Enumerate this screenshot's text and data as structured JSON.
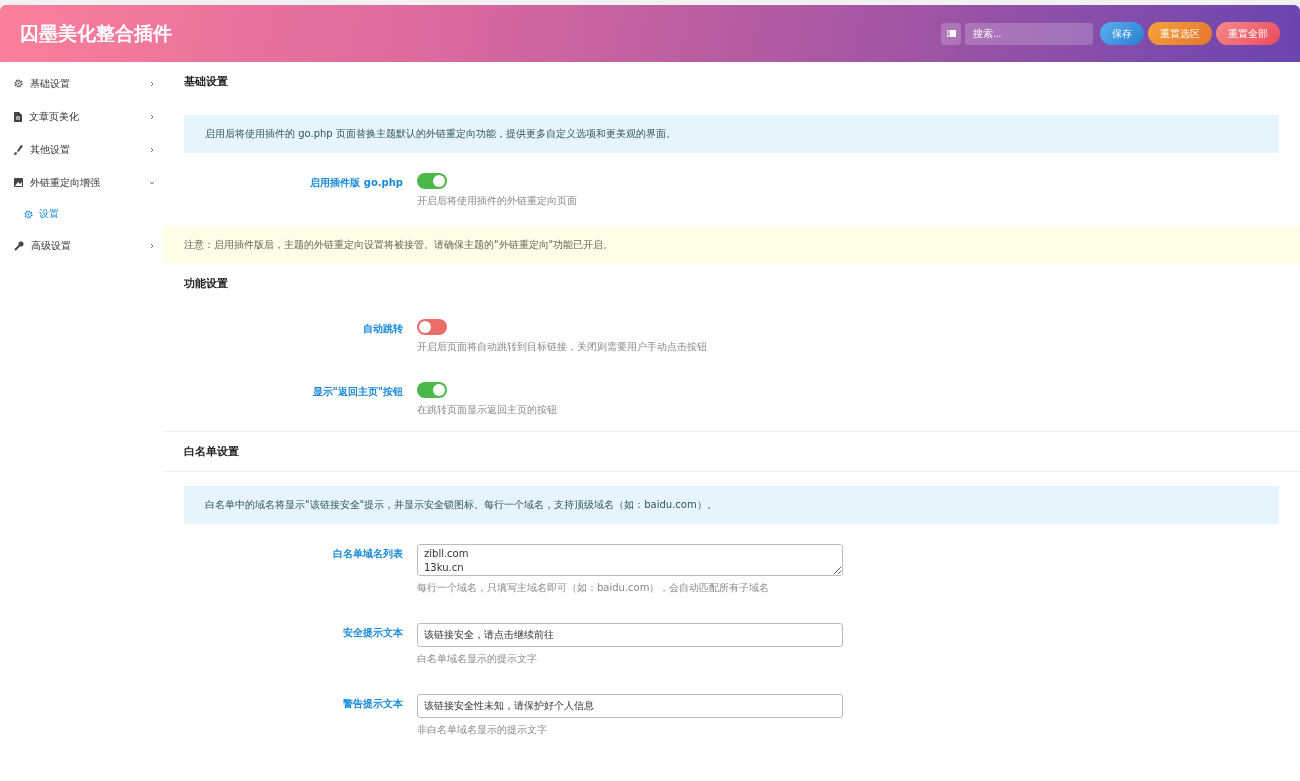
{
  "header": {
    "title": "囚墨美化整合插件",
    "search": {
      "placeholder": "搜索..."
    },
    "buttons": [
      {
        "kind": "save",
        "label": "保存"
      },
      {
        "kind": "reset-section",
        "label": "重置选区"
      },
      {
        "kind": "reset-all",
        "label": "重置全部"
      }
    ]
  },
  "sidebar": {
    "items": [
      {
        "label": "基础设置",
        "expanded": false
      },
      {
        "label": "文章页美化",
        "expanded": false
      },
      {
        "label": "其他设置",
        "expanded": false
      },
      {
        "label": "外链重定向增强",
        "expanded": true,
        "children": [
          {
            "label": "设置",
            "selected": true
          }
        ]
      },
      {
        "label": "高级设置",
        "expanded": false
      }
    ]
  },
  "sections": [
    {
      "title": "基础设置",
      "items": [
        {
          "kind": "info",
          "text": "启用后将使用插件的 go.php 页面替换主题默认的外链重定向功能，提供更多自定义选项和更美观的界面。"
        },
        {
          "kind": "switch",
          "label": "启用插件版 go.php",
          "on": true,
          "description": "开启后将使用插件的外链重定向页面"
        },
        {
          "kind": "notice",
          "text": "注意：启用插件版后，主题的外链重定向设置将被接管。请确保主题的\"外链重定向\"功能已开启。"
        }
      ]
    },
    {
      "title": "功能设置",
      "items": [
        {
          "kind": "switch",
          "label": "自动跳转",
          "on": false,
          "description": "开启后页面将自动跳转到目标链接，关闭则需要用户手动点击按钮"
        },
        {
          "kind": "switch",
          "label": "显示\"返回主页\"按钮",
          "on": true,
          "description": "在跳转页面显示返回主页的按钮"
        }
      ]
    },
    {
      "title": "白名单设置",
      "items": [
        {
          "kind": "info",
          "text": "白名单中的域名将显示\"该链接安全\"提示，并显示安全锁图标。每行一个域名，支持顶级域名（如：baidu.com）。"
        },
        {
          "kind": "textarea",
          "label": "白名单域名列表",
          "value": "zibll.com\n13ku.cn",
          "description": "每行一个域名，只填写主域名即可（如：baidu.com），会自动匹配所有子域名"
        },
        {
          "kind": "text",
          "label": "安全提示文本",
          "value": "该链接安全，请点击继续前往",
          "description": "白名单域名显示的提示文字"
        },
        {
          "kind": "text",
          "label": "警告提示文本",
          "value": "该链接安全性未知，请保护好个人信息",
          "description": "非白名单域名显示的提示文字"
        }
      ]
    }
  ]
}
